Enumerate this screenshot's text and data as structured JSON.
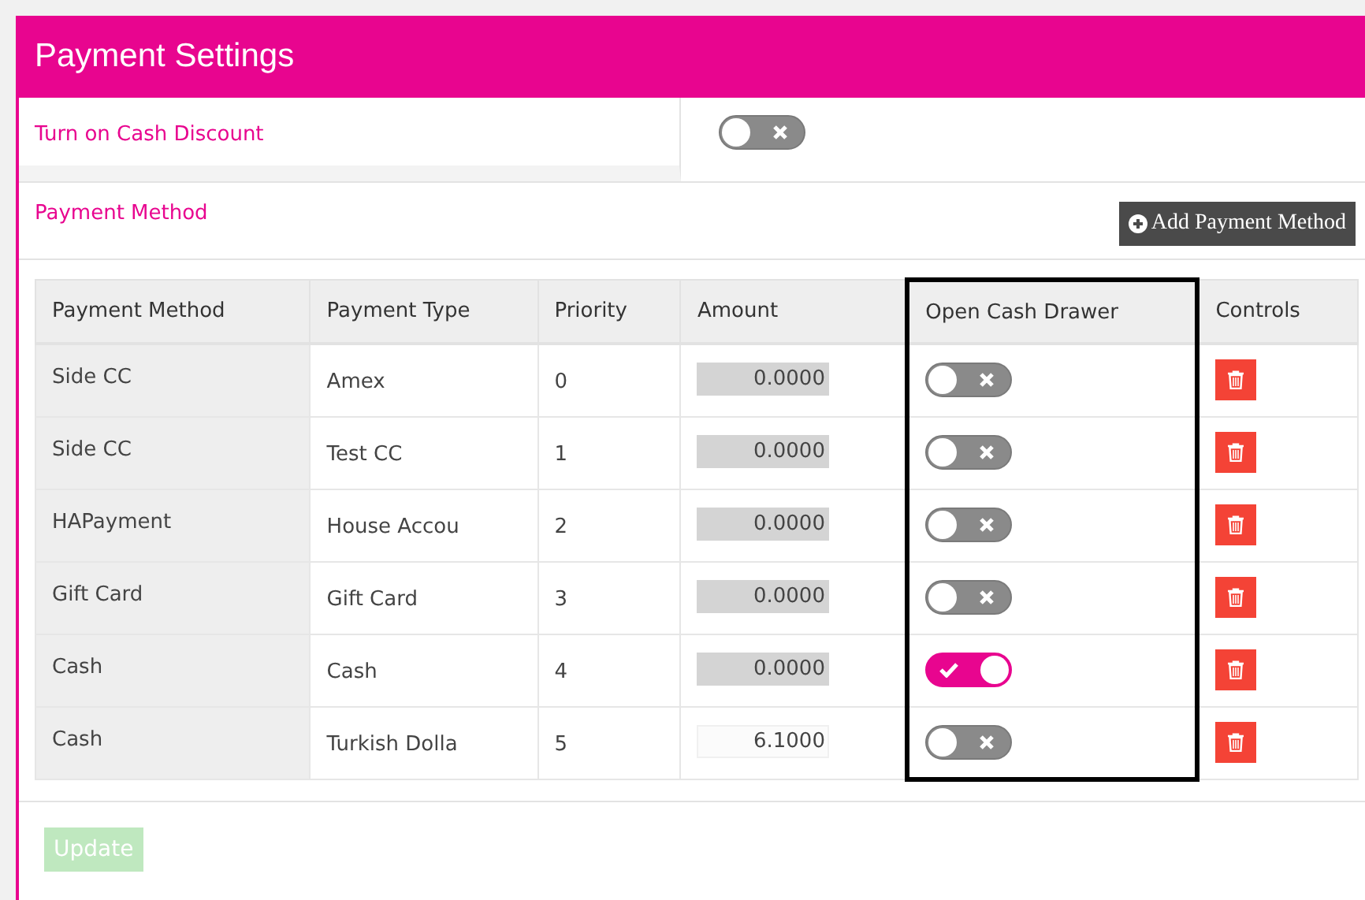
{
  "panel": {
    "title": "Payment Settings"
  },
  "cash_discount": {
    "label": "Turn on Cash Discount",
    "on": false
  },
  "payment_method_section": {
    "label": "Payment Method",
    "add_button": "Add Payment Method"
  },
  "table": {
    "columns": [
      "Payment Method",
      "Payment Type",
      "Priority",
      "Amount",
      "Open Cash Drawer",
      "Controls"
    ],
    "rows": [
      {
        "method": "Side CC",
        "type": "Amex",
        "priority": "0",
        "amount": "0.0000",
        "amount_disabled": true,
        "open_cash_drawer": false
      },
      {
        "method": "Side CC",
        "type": "Test CC",
        "priority": "1",
        "amount": "0.0000",
        "amount_disabled": true,
        "open_cash_drawer": false
      },
      {
        "method": "HAPayment",
        "type": "House Accou",
        "priority": "2",
        "amount": "0.0000",
        "amount_disabled": true,
        "open_cash_drawer": false
      },
      {
        "method": "Gift Card",
        "type": "Gift Card",
        "priority": "3",
        "amount": "0.0000",
        "amount_disabled": true,
        "open_cash_drawer": false
      },
      {
        "method": "Cash",
        "type": "Cash",
        "priority": "4",
        "amount": "0.0000",
        "amount_disabled": true,
        "open_cash_drawer": true
      },
      {
        "method": "Cash",
        "type": "Turkish Dolla",
        "priority": "5",
        "amount": "6.1000",
        "amount_disabled": false,
        "open_cash_drawer": false
      }
    ]
  },
  "update_button": {
    "label": "Update",
    "disabled": true
  }
}
